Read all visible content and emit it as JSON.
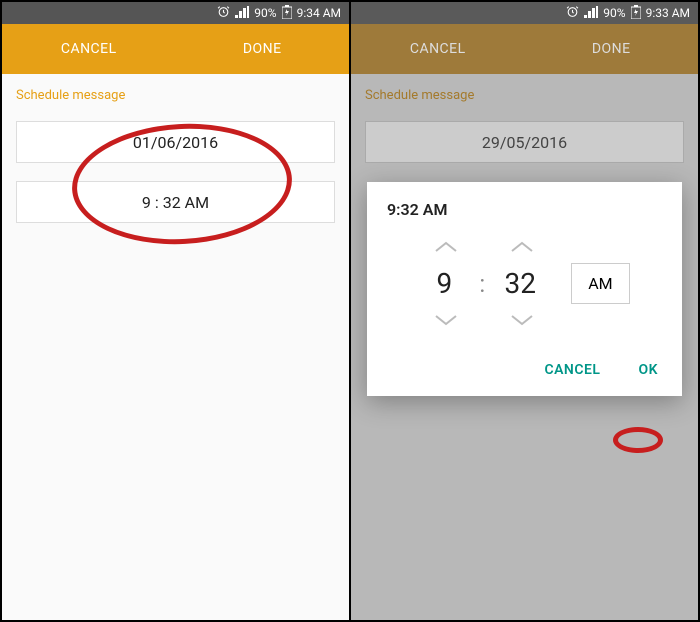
{
  "left": {
    "status": {
      "battery": "90%",
      "time": "9:34 AM"
    },
    "actions": {
      "cancel": "CANCEL",
      "done": "DONE"
    },
    "section_label": "Schedule message",
    "date_field": "01/06/2016",
    "time_field": "9 : 32 AM"
  },
  "right": {
    "status": {
      "battery": "90%",
      "time": "9:33 AM"
    },
    "actions": {
      "cancel": "CANCEL",
      "done": "DONE"
    },
    "section_label": "Schedule message",
    "date_field": "29/05/2016",
    "dialog": {
      "title": "9:32 AM",
      "hour": "9",
      "minute": "32",
      "ampm": "AM",
      "cancel": "CANCEL",
      "ok": "OK"
    }
  }
}
